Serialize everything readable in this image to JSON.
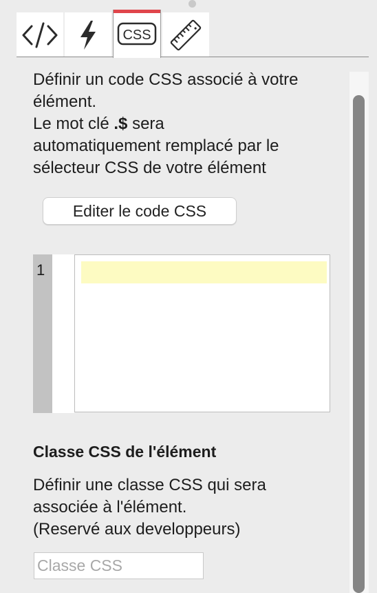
{
  "tabs": [
    {
      "id": "html",
      "icon": "code-brackets-icon"
    },
    {
      "id": "events",
      "icon": "lightning-icon"
    },
    {
      "id": "css",
      "icon": "css-box-icon",
      "label": "CSS",
      "active": true
    },
    {
      "id": "dimensions",
      "icon": "ruler-icon"
    }
  ],
  "colors": {
    "active_tab": "#e0454b",
    "line_highlight": "#fdfbc2",
    "scrollbar_thumb": "#858585"
  },
  "css_section": {
    "description_lines": [
      "Définir un code CSS associé à votre",
      "élément."
    ],
    "keyword_prefix": "Le mot clé ",
    "keyword": ".$",
    "keyword_suffix": " sera",
    "description_tail": [
      "automatiquement remplacé par le",
      "sélecteur CSS de votre élément"
    ],
    "edit_button_label": "Editer le code CSS"
  },
  "editor": {
    "line_numbers": [
      "1"
    ],
    "content": ""
  },
  "class_section": {
    "title": "Classe CSS de l'élément",
    "description_lines": [
      "Définir une classe CSS qui sera",
      "associée à l'élément.",
      "(Reservé aux developpeurs)"
    ],
    "input_placeholder": "Classe CSS",
    "input_value": ""
  }
}
